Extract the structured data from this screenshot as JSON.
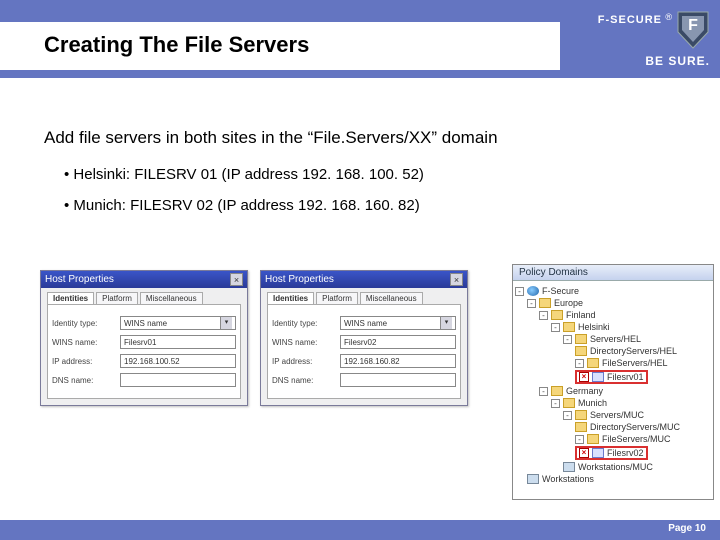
{
  "brand": {
    "name": "F-SECURE",
    "reg": "®",
    "tagline": "BE SURE."
  },
  "title": "Creating The File Servers",
  "lead": "Add file servers in both sites in the “File.Servers/XX” domain",
  "bullets": [
    "Helsinki: FILESRV 01  (IP address 192. 168. 100. 52)",
    "Munich: FILESRV 02  (IP address 192. 168. 160. 82)"
  ],
  "dialog": {
    "title": "Host Properties",
    "tabs": [
      "Identities",
      "Platform",
      "Miscellaneous"
    ],
    "labels": {
      "idtype": "Identity type:",
      "wins": "WINS name:",
      "ip": "IP address:",
      "dns": "DNS name:"
    },
    "idtype_value": "WINS name",
    "close": "×"
  },
  "host1": {
    "wins": "Filesrv01",
    "ip": "192.168.100.52",
    "dns": ""
  },
  "host2": {
    "wins": "Filesrv02",
    "ip": "192.168.160.82",
    "dns": ""
  },
  "tree": {
    "title": "Policy Domains",
    "root": "F-Secure",
    "eu": "Europe",
    "fi": "Finland",
    "hel": "Helsinki",
    "srv_hel": "Servers/HEL",
    "dir_hel": "DirectoryServers/HEL",
    "fs_hel": "FileServers/HEL",
    "node_hel": "Filesrv01",
    "de": "Germany",
    "muc": "Munich",
    "srv_muc": "Servers/MUC",
    "dir_muc": "DirectoryServers/MUC",
    "fs_muc": "FileServers/MUC",
    "node_muc": "Filesrv02",
    "ws_muc": "Workstations/MUC",
    "ws": "Workstations"
  },
  "footer": {
    "page": "Page 10"
  }
}
